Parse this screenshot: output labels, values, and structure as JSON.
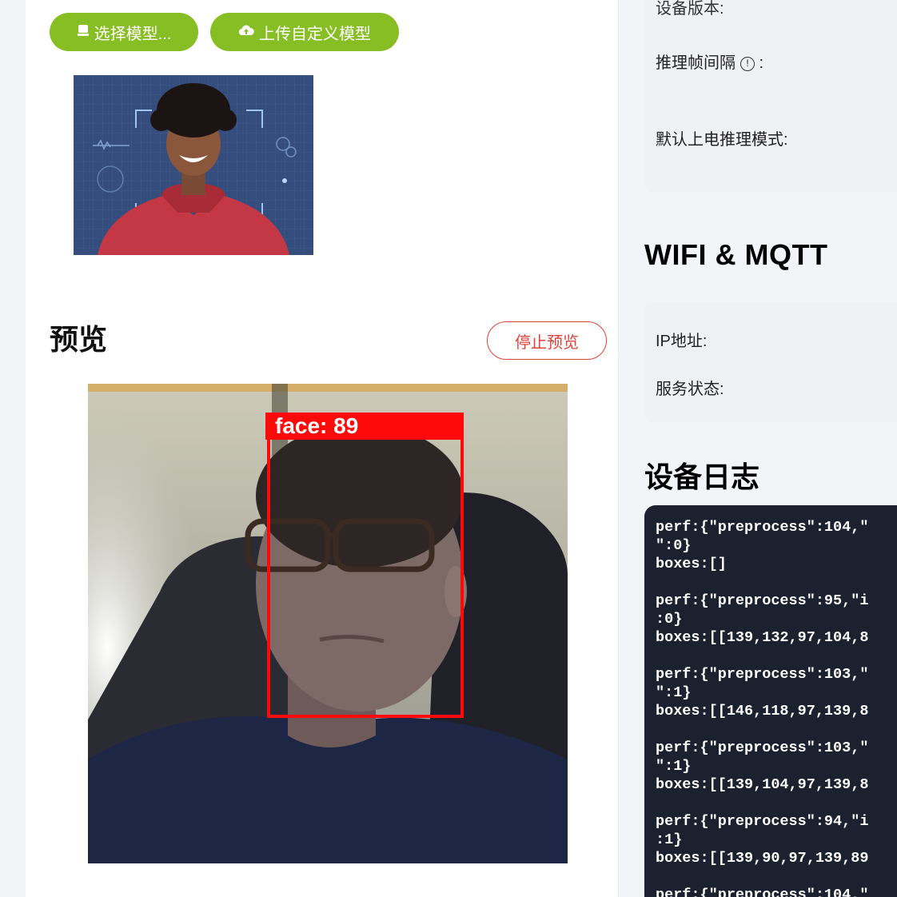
{
  "toolbar": {
    "select_model_label": "选择模型...",
    "upload_model_label": "上传自定义模型"
  },
  "preview": {
    "title": "预览",
    "stop_button_label": "停止预览",
    "detection_label": "face: 89"
  },
  "device_settings": {
    "partial_label": "设备版本:",
    "inference_interval_label": "推理帧间隔",
    "default_mode_label": "默认上电推理模式:"
  },
  "wifi_mqtt": {
    "title": "WIFI & MQTT",
    "ip_label": "IP地址:",
    "service_status_label": "服务状态:"
  },
  "device_log": {
    "title": "设备日志",
    "lines": [
      "perf:{\"preprocess\":104,\"",
      "\":0}",
      "boxes:[]",
      "",
      "perf:{\"preprocess\":95,\"i",
      ":0}",
      "boxes:[[139,132,97,104,8",
      "",
      "perf:{\"preprocess\":103,\"",
      "\":1}",
      "boxes:[[146,118,97,139,8",
      "",
      "perf:{\"preprocess\":103,\"",
      "\":1}",
      "boxes:[[139,104,97,139,8",
      "",
      "perf:{\"preprocess\":94,\"i",
      ":1}",
      "boxes:[[139,90,97,139,89",
      "",
      "perf:{\"preprocess\":104,\""
    ]
  },
  "colors": {
    "accent_green": "#86be24",
    "stop_red": "#e0413b",
    "bbox_red": "#ff0a0a",
    "log_bg": "#1c2130"
  },
  "icons": {
    "select_model": "chip-icon",
    "upload_model": "cloud-upload-icon",
    "info": "info-circle-icon"
  }
}
